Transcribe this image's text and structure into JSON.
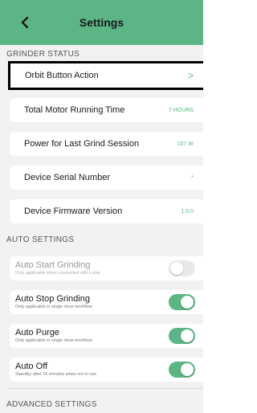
{
  "header": {
    "title": "Settings",
    "back_icon": "chevron-left-icon"
  },
  "sections": {
    "grinder_status": "GRINDER STATUS",
    "auto_settings": "AUTO SETTINGS",
    "advanced_settings": "ADVANCED SETTINGS"
  },
  "grinder_status": {
    "orbit": {
      "label": "Orbit Button Action",
      "chevron": ">"
    },
    "motor": {
      "label": "Total Motor Running Time",
      "value": "7 HOURS"
    },
    "power": {
      "label": "Power for Last Grind Session",
      "value": "107 W"
    },
    "serial": {
      "label": "Device Serial Number",
      "value": ".*"
    },
    "firmware": {
      "label": "Device Firmware Version",
      "value": "1.0.0"
    }
  },
  "auto_settings": {
    "start": {
      "title": "Auto Start Grinding",
      "subtitle": "Only applicable when connected with Lunar",
      "on": false,
      "enabled": false
    },
    "stop": {
      "title": "Auto Stop Grinding",
      "subtitle": "Only applicable in single dose workflow",
      "on": true,
      "enabled": true
    },
    "purge": {
      "title": "Auto Purge",
      "subtitle": "Only applicable in single dose workflow",
      "on": true,
      "enabled": true
    },
    "off": {
      "title": "Auto Off",
      "subtitle": "Standby after 15 minutes when not in use",
      "on": true,
      "enabled": true
    }
  },
  "colors": {
    "accent": "#5bb585",
    "background": "#f2f2f2"
  }
}
